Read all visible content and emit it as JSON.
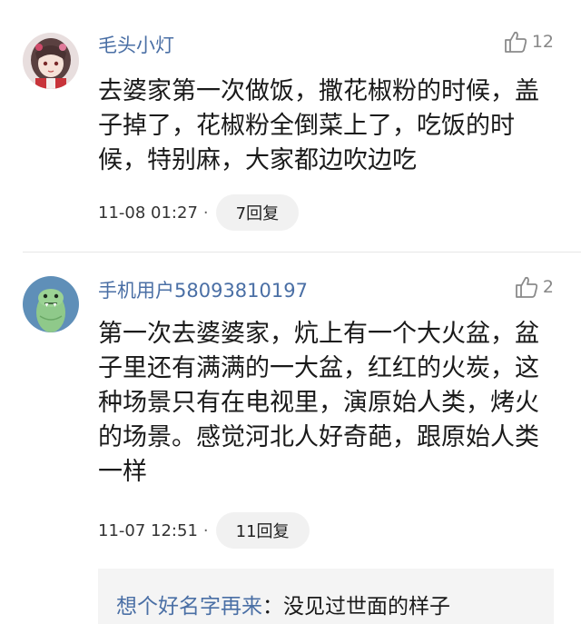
{
  "comments": [
    {
      "username": "毛头小灯",
      "likes": "12",
      "text": "去婆家第一次做饭，撒花椒粉的时候，盖子掉了，花椒粉全倒菜上了，吃饭的时候，特别麻，大家都边吹边吃",
      "time": "11-08 01:27",
      "separator": "·",
      "replies": "7回复",
      "avatar_icon": "anime-girl-avatar"
    },
    {
      "username": "手机用户58093810197",
      "likes": "2",
      "text": "第一次去婆婆家，炕上有一个大火盆，盆子里还有满满的一大盆，红红的火炭，这种场景只有在电视里，演原始人类，烤火的场景。感觉河北人好奇葩，跟原始人类一样",
      "time": "11-07 12:51",
      "separator": "·",
      "replies": "11回复",
      "avatar_icon": "green-dinosaur-avatar",
      "sub_reply": {
        "user": "想个好名字再来",
        "text": "：没见过世面的样子"
      }
    }
  ],
  "colors": {
    "username": "#4a6fa5",
    "reply_bg": "#f1f1f1",
    "sub_reply_bg": "#f4f4f4"
  }
}
